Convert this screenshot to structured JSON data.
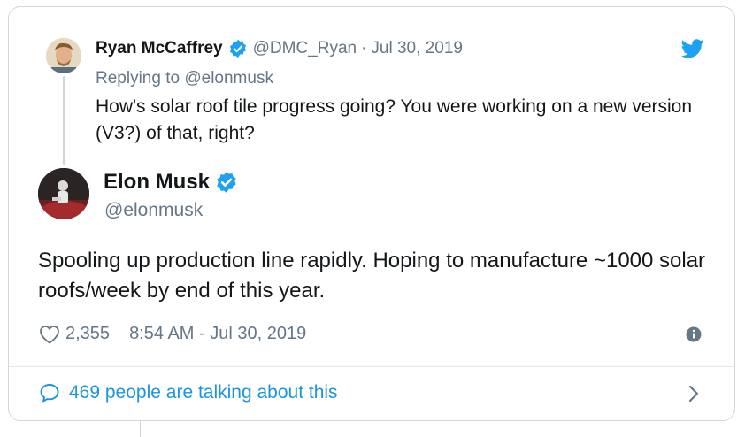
{
  "parent": {
    "name": "Ryan McCaffrey",
    "handle": "@DMC_Ryan",
    "separator": "·",
    "date": "Jul 30, 2019",
    "replying_prefix": "Replying to",
    "replying_to": "@elonmusk",
    "text": "How's solar roof tile progress going? You were working on a new version (V3?) of that, right?"
  },
  "tweet": {
    "name": "Elon Musk",
    "handle": "@elonmusk",
    "text": "Spooling up production line rapidly. Hoping to manufacture ~1000 solar roofs/week by end of this year.",
    "likes": "2,355",
    "timestamp": "8:54 AM - Jul 30, 2019"
  },
  "footer": {
    "talking": "469 people are talking about this"
  },
  "colors": {
    "accent": "#1da1f2",
    "link": "#1b95e0",
    "muted": "#657786",
    "text": "#14171a",
    "border": "#cfd9de"
  },
  "icons": [
    "twitter-bird-icon",
    "verified-badge-icon",
    "heart-icon",
    "info-icon",
    "comment-bubble-icon",
    "chevron-right-icon"
  ]
}
